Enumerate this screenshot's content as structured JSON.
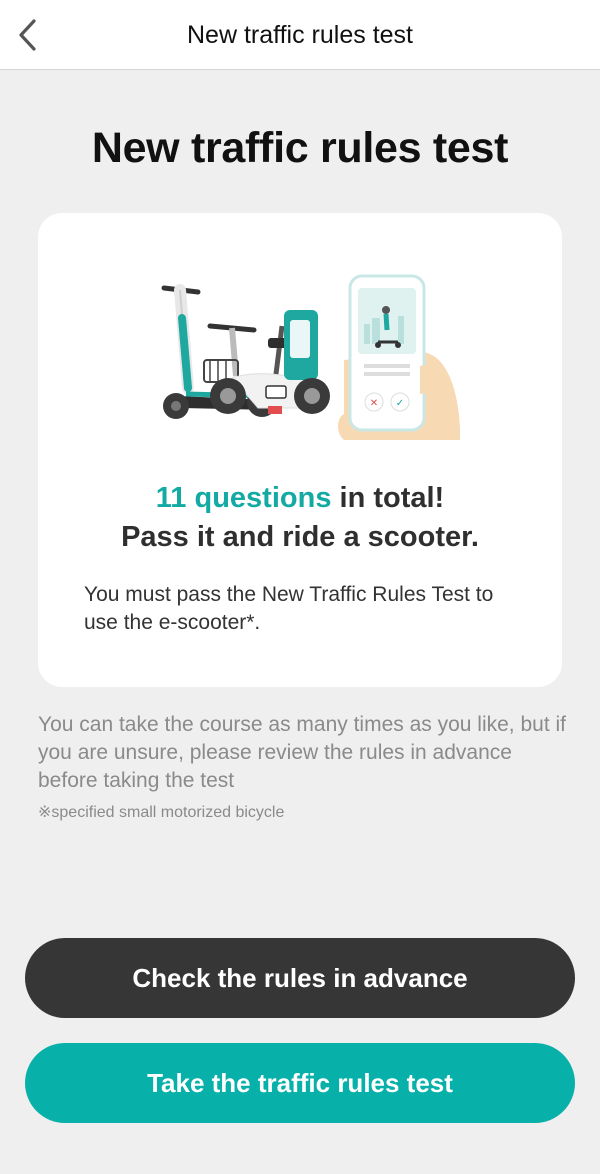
{
  "nav": {
    "back_icon": "chevron-left-icon",
    "title": "New traffic rules test"
  },
  "page_title": "New traffic rules test",
  "card": {
    "illustration": "scooters-and-phone-illustration",
    "headline_accent": "11 questions",
    "headline_rest": " in total!",
    "headline_line2": "Pass it and ride a scooter.",
    "description": "You must pass the New Traffic Rules Test to use the e-scooter*.",
    "accent_color": "#12aaa3"
  },
  "info_text": "You can take the course as many times as you like, but if you are unsure, please review the rules in advance before taking the test",
  "footnote": "※specified small motorized bicycle",
  "buttons": {
    "check_rules": "Check the rules in advance",
    "take_test": "Take the traffic rules test"
  },
  "colors": {
    "dark_button": "#363636",
    "teal_button": "#07b0a8",
    "background": "#efefef"
  }
}
